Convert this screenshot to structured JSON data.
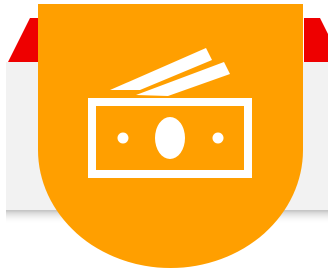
{
  "colors": {
    "ribbon_red": "#ee0000",
    "ribbon_red_dark": "#c80000",
    "card_bg": "#f2f2f2",
    "card_shadow": "#cfcfcf",
    "badge_orange": "#ff9f00",
    "icon_white": "#ffffff"
  },
  "icons": {
    "badge_icon": "money-bills-icon"
  }
}
